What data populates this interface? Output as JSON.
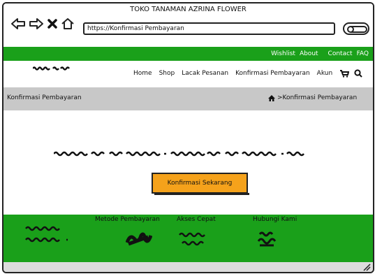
{
  "window": {
    "title": "TOKO TANAMAN AZRINA FLOWER",
    "url": "https://Konfirmasi Pembayaran"
  },
  "topbar": {
    "links": [
      "Wishlist",
      "About",
      "Contact",
      "FAQ"
    ]
  },
  "nav": {
    "items": [
      "Home",
      "Shop",
      "Lacak Pesanan",
      "Konfirmasi Pembayaran",
      "Akun"
    ],
    "cart_icon": "cart-icon",
    "search_icon": "search-icon"
  },
  "breadcrumb": {
    "title": "Konfirmasi Pembayaran",
    "home_icon": "home-icon",
    "separator": ">",
    "current": "Konfirmasi Pembayaran"
  },
  "main": {
    "button_label": "Konfirmasi Sekarang"
  },
  "footer": {
    "columns": [
      "Metode Pembayaran",
      "Akses Cepat",
      "Hubungi Kami"
    ]
  },
  "colors": {
    "green": "#1aa01a",
    "orange": "#f5a21b",
    "gray": "#c8c8c8"
  }
}
